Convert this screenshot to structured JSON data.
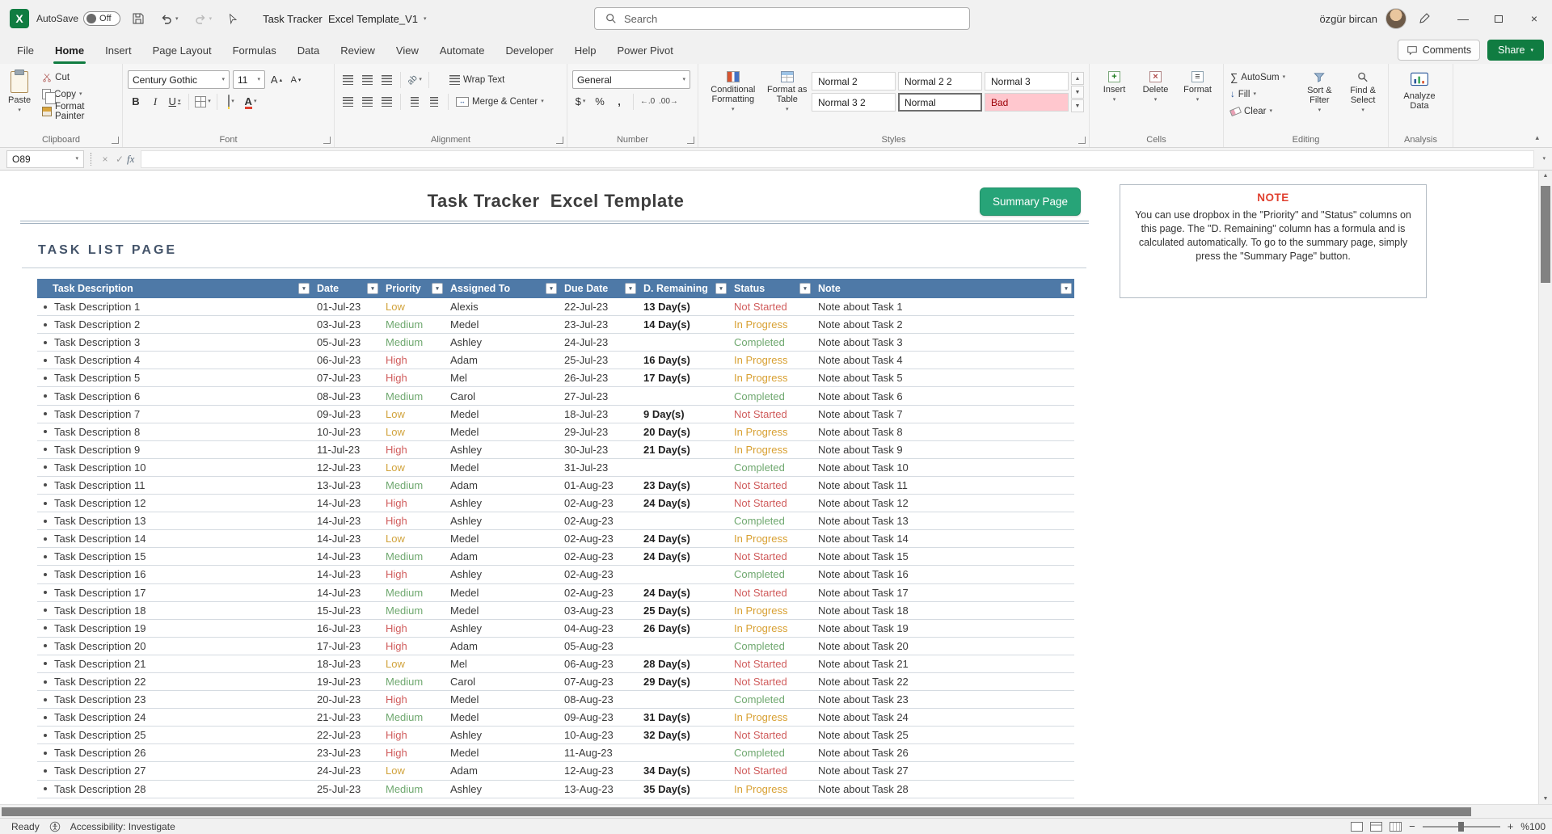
{
  "colors": {
    "accent_green": "#107c41",
    "summary_green": "#27a478",
    "header_blue": "#4e79a7",
    "note_title": "#e0402f",
    "bad_bg": "#ffc7ce",
    "bad_text": "#9c0006",
    "priority": {
      "Low": "#d1a33c",
      "Medium": "#6fa86f",
      "High": "#d05c5c"
    },
    "status": {
      "Not Started": "#d05c5c",
      "In Progress": "#d8a032",
      "Completed": "#6fa86f"
    }
  },
  "titlebar": {
    "autosave_label": "AutoSave",
    "autosave_state": "Off",
    "doc_title": "Task Tracker  Excel Template_V1",
    "search_placeholder": "Search",
    "user_name": "özgür bircan"
  },
  "tabs": [
    "File",
    "Home",
    "Insert",
    "Page Layout",
    "Formulas",
    "Data",
    "Review",
    "View",
    "Automate",
    "Developer",
    "Help",
    "Power Pivot"
  ],
  "active_tab": "Home",
  "top_right": {
    "comments": "Comments",
    "share": "Share"
  },
  "ribbon": {
    "clipboard": {
      "label": "Clipboard",
      "paste": "Paste",
      "cut": "Cut",
      "copy": "Copy",
      "format_painter": "Format Painter"
    },
    "font": {
      "label": "Font",
      "family": "Century Gothic",
      "size": "11",
      "bold": "B",
      "italic": "I",
      "underline": "U"
    },
    "alignment": {
      "label": "Alignment",
      "wrap": "Wrap Text",
      "merge": "Merge & Center"
    },
    "number": {
      "label": "Number",
      "format": "General"
    },
    "styles": {
      "label": "Styles",
      "conditional": "Conditional Formatting",
      "format_table": "Format as Table",
      "gallery": [
        "Normal 2",
        "Normal 2 2",
        "Normal 3",
        "Normal 3 2",
        "Normal",
        "Bad"
      ],
      "selected": "Normal",
      "bad": "Bad"
    },
    "cells": {
      "label": "Cells",
      "insert": "Insert",
      "delete": "Delete",
      "format": "Format"
    },
    "editing": {
      "label": "Editing",
      "autosum": "AutoSum",
      "fill": "Fill",
      "clear": "Clear",
      "sort": "Sort & Filter",
      "find": "Find & Select"
    },
    "analysis": {
      "label": "Analysis",
      "analyze": "Analyze Data"
    }
  },
  "formula_bar": {
    "cell_ref": "O89",
    "fx": "fx"
  },
  "sheet": {
    "title": "Task Tracker  Excel Template",
    "summary_button": "Summary Page",
    "section_title": "TASK LIST PAGE",
    "note_title": "NOTE",
    "note_body": "You can use dropbox in the \"Priority\" and \"Status\" columns on this page. The \"D. Remaining\" column has a formula and is calculated automatically. To go to the summary page, simply press the \"Summary Page\" button."
  },
  "table": {
    "columns": [
      "Task Description",
      "Date",
      "Priority",
      "Assigned To",
      "Due Date",
      "D. Remaining",
      "Status",
      "Note"
    ],
    "rows": [
      {
        "desc": "Task Description 1",
        "date": "01-Jul-23",
        "priority": "Low",
        "assigned": "Alexis",
        "due": "22-Jul-23",
        "remaining": "13 Day(s)",
        "status": "Not Started",
        "note": "Note about Task 1"
      },
      {
        "desc": "Task Description 2",
        "date": "03-Jul-23",
        "priority": "Medium",
        "assigned": "Medel",
        "due": "23-Jul-23",
        "remaining": "14 Day(s)",
        "status": "In Progress",
        "note": "Note about Task 2"
      },
      {
        "desc": "Task Description 3",
        "date": "05-Jul-23",
        "priority": "Medium",
        "assigned": "Ashley",
        "due": "24-Jul-23",
        "remaining": "",
        "status": "Completed",
        "note": "Note about Task 3"
      },
      {
        "desc": "Task Description 4",
        "date": "06-Jul-23",
        "priority": "High",
        "assigned": "Adam",
        "due": "25-Jul-23",
        "remaining": "16 Day(s)",
        "status": "In Progress",
        "note": "Note about Task 4"
      },
      {
        "desc": "Task Description 5",
        "date": "07-Jul-23",
        "priority": "High",
        "assigned": "Mel",
        "due": "26-Jul-23",
        "remaining": "17 Day(s)",
        "status": "In Progress",
        "note": "Note about Task 5"
      },
      {
        "desc": "Task Description 6",
        "date": "08-Jul-23",
        "priority": "Medium",
        "assigned": "Carol",
        "due": "27-Jul-23",
        "remaining": "",
        "status": "Completed",
        "note": "Note about Task 6"
      },
      {
        "desc": "Task Description 7",
        "date": "09-Jul-23",
        "priority": "Low",
        "assigned": "Medel",
        "due": "18-Jul-23",
        "remaining": "9 Day(s)",
        "status": "Not Started",
        "note": "Note about Task 7"
      },
      {
        "desc": "Task Description 8",
        "date": "10-Jul-23",
        "priority": "Low",
        "assigned": "Medel",
        "due": "29-Jul-23",
        "remaining": "20 Day(s)",
        "status": "In Progress",
        "note": "Note about Task 8"
      },
      {
        "desc": "Task Description 9",
        "date": "11-Jul-23",
        "priority": "High",
        "assigned": "Ashley",
        "due": "30-Jul-23",
        "remaining": "21 Day(s)",
        "status": "In Progress",
        "note": "Note about Task 9"
      },
      {
        "desc": "Task Description 10",
        "date": "12-Jul-23",
        "priority": "Low",
        "assigned": "Medel",
        "due": "31-Jul-23",
        "remaining": "",
        "status": "Completed",
        "note": "Note about Task 10"
      },
      {
        "desc": "Task Description 11",
        "date": "13-Jul-23",
        "priority": "Medium",
        "assigned": "Adam",
        "due": "01-Aug-23",
        "remaining": "23 Day(s)",
        "status": "Not Started",
        "note": "Note about Task 11"
      },
      {
        "desc": "Task Description 12",
        "date": "14-Jul-23",
        "priority": "High",
        "assigned": "Ashley",
        "due": "02-Aug-23",
        "remaining": "24 Day(s)",
        "status": "Not Started",
        "note": "Note about Task 12"
      },
      {
        "desc": "Task Description 13",
        "date": "14-Jul-23",
        "priority": "High",
        "assigned": "Ashley",
        "due": "02-Aug-23",
        "remaining": "",
        "status": "Completed",
        "note": "Note about Task 13"
      },
      {
        "desc": "Task Description 14",
        "date": "14-Jul-23",
        "priority": "Low",
        "assigned": "Medel",
        "due": "02-Aug-23",
        "remaining": "24 Day(s)",
        "status": "In Progress",
        "note": "Note about Task 14"
      },
      {
        "desc": "Task Description 15",
        "date": "14-Jul-23",
        "priority": "Medium",
        "assigned": "Adam",
        "due": "02-Aug-23",
        "remaining": "24 Day(s)",
        "status": "Not Started",
        "note": "Note about Task 15"
      },
      {
        "desc": "Task Description 16",
        "date": "14-Jul-23",
        "priority": "High",
        "assigned": "Ashley",
        "due": "02-Aug-23",
        "remaining": "",
        "status": "Completed",
        "note": "Note about Task 16"
      },
      {
        "desc": "Task Description 17",
        "date": "14-Jul-23",
        "priority": "Medium",
        "assigned": "Medel",
        "due": "02-Aug-23",
        "remaining": "24 Day(s)",
        "status": "Not Started",
        "note": "Note about Task 17"
      },
      {
        "desc": "Task Description 18",
        "date": "15-Jul-23",
        "priority": "Medium",
        "assigned": "Medel",
        "due": "03-Aug-23",
        "remaining": "25 Day(s)",
        "status": "In Progress",
        "note": "Note about Task 18"
      },
      {
        "desc": "Task Description 19",
        "date": "16-Jul-23",
        "priority": "High",
        "assigned": "Ashley",
        "due": "04-Aug-23",
        "remaining": "26 Day(s)",
        "status": "In Progress",
        "note": "Note about Task 19"
      },
      {
        "desc": "Task Description 20",
        "date": "17-Jul-23",
        "priority": "High",
        "assigned": "Adam",
        "due": "05-Aug-23",
        "remaining": "",
        "status": "Completed",
        "note": "Note about Task 20"
      },
      {
        "desc": "Task Description 21",
        "date": "18-Jul-23",
        "priority": "Low",
        "assigned": "Mel",
        "due": "06-Aug-23",
        "remaining": "28 Day(s)",
        "status": "Not Started",
        "note": "Note about Task 21"
      },
      {
        "desc": "Task Description 22",
        "date": "19-Jul-23",
        "priority": "Medium",
        "assigned": "Carol",
        "due": "07-Aug-23",
        "remaining": "29 Day(s)",
        "status": "Not Started",
        "note": "Note about Task 22"
      },
      {
        "desc": "Task Description 23",
        "date": "20-Jul-23",
        "priority": "High",
        "assigned": "Medel",
        "due": "08-Aug-23",
        "remaining": "",
        "status": "Completed",
        "note": "Note about Task 23"
      },
      {
        "desc": "Task Description 24",
        "date": "21-Jul-23",
        "priority": "Medium",
        "assigned": "Medel",
        "due": "09-Aug-23",
        "remaining": "31 Day(s)",
        "status": "In Progress",
        "note": "Note about Task 24"
      },
      {
        "desc": "Task Description 25",
        "date": "22-Jul-23",
        "priority": "High",
        "assigned": "Ashley",
        "due": "10-Aug-23",
        "remaining": "32 Day(s)",
        "status": "Not Started",
        "note": "Note about Task 25"
      },
      {
        "desc": "Task Description 26",
        "date": "23-Jul-23",
        "priority": "High",
        "assigned": "Medel",
        "due": "11-Aug-23",
        "remaining": "",
        "status": "Completed",
        "note": "Note about Task 26"
      },
      {
        "desc": "Task Description 27",
        "date": "24-Jul-23",
        "priority": "Low",
        "assigned": "Adam",
        "due": "12-Aug-23",
        "remaining": "34 Day(s)",
        "status": "Not Started",
        "note": "Note about Task 27"
      },
      {
        "desc": "Task Description 28",
        "date": "25-Jul-23",
        "priority": "Medium",
        "assigned": "Ashley",
        "due": "13-Aug-23",
        "remaining": "35 Day(s)",
        "status": "In Progress",
        "note": "Note about Task 28"
      }
    ]
  },
  "statusbar": {
    "ready": "Ready",
    "accessibility": "Accessibility: Investigate",
    "zoom_label": "%100"
  }
}
